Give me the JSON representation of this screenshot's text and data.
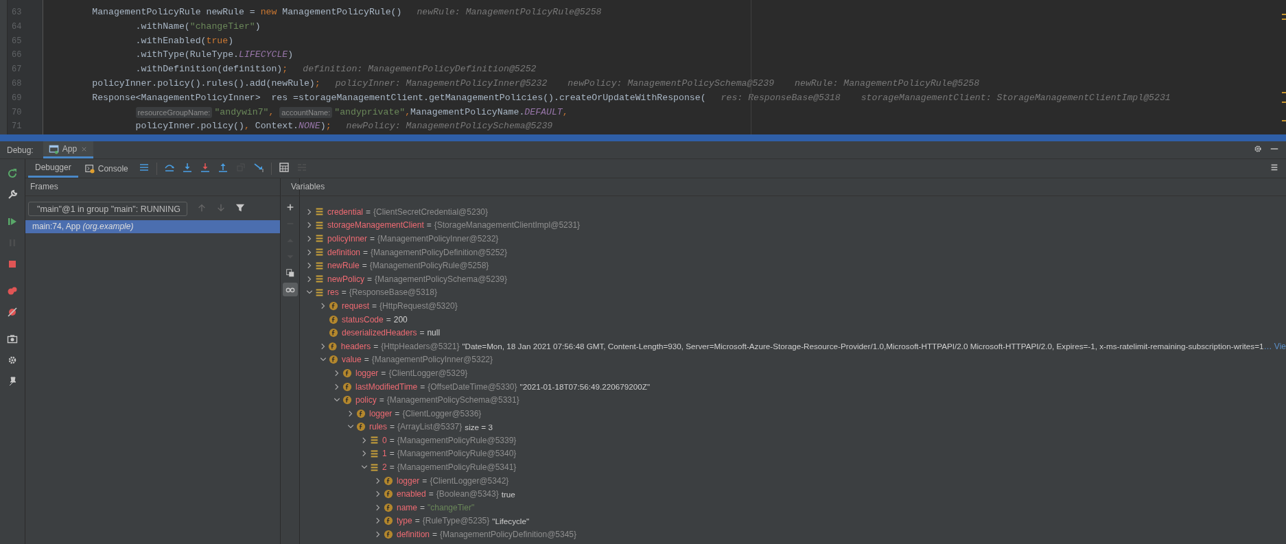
{
  "editor": {
    "lines": [
      {
        "number": "63",
        "continuation": false,
        "tokens": [
          {
            "kind": "plain",
            "text": "ManagementPolicyRule newRule = "
          },
          {
            "kind": "keyword",
            "text": "new"
          },
          {
            "kind": "plain",
            "text": " ManagementPolicyRule()"
          },
          {
            "kind": "hint",
            "text": "newRule: ManagementPolicyRule@5258"
          }
        ]
      },
      {
        "number": "64",
        "continuation": true,
        "tokens": [
          {
            "kind": "plain",
            "text": ".withName("
          },
          {
            "kind": "string",
            "text": "\"changeTier\""
          },
          {
            "kind": "plain",
            "text": ")"
          }
        ]
      },
      {
        "number": "65",
        "continuation": true,
        "tokens": [
          {
            "kind": "plain",
            "text": ".withEnabled("
          },
          {
            "kind": "keyword",
            "text": "true"
          },
          {
            "kind": "plain",
            "text": ")"
          }
        ]
      },
      {
        "number": "66",
        "continuation": true,
        "tokens": [
          {
            "kind": "plain",
            "text": ".withType(RuleType."
          },
          {
            "kind": "constant",
            "text": "LIFECYCLE"
          },
          {
            "kind": "plain",
            "text": ")"
          }
        ]
      },
      {
        "number": "67",
        "continuation": true,
        "tokens": [
          {
            "kind": "plain",
            "text": ".withDefinition(definition)"
          },
          {
            "kind": "keyword",
            "text": ";"
          },
          {
            "kind": "hint",
            "text": "definition: ManagementPolicyDefinition@5252"
          }
        ]
      },
      {
        "number": "68",
        "continuation": false,
        "tokens": [
          {
            "kind": "plain",
            "text": "policyInner.policy().rules().add(newRule)"
          },
          {
            "kind": "keyword",
            "text": ";"
          },
          {
            "kind": "hint",
            "text": "policyInner: ManagementPolicyInner@5232"
          },
          {
            "kind": "hint",
            "text": "newPolicy: ManagementPolicySchema@5239"
          },
          {
            "kind": "hint",
            "text": "newRule: ManagementPolicyRule@5258"
          }
        ]
      },
      {
        "number": "69",
        "continuation": false,
        "tokens": [
          {
            "kind": "plain",
            "text": "Response<ManagementPolicyInner>  res =storageManagementClient.getManagementPolicies().createOrUpdateWithResponse("
          },
          {
            "kind": "hint",
            "text": "res: ResponseBase@5318"
          },
          {
            "kind": "hint",
            "text": "storageManagementClient: StorageManagementClientImpl@5231"
          }
        ]
      },
      {
        "number": "70",
        "continuation": true,
        "tokens": [
          {
            "kind": "param",
            "text": "resourceGroupName:"
          },
          {
            "kind": "string",
            "text": "\"andywin7\""
          },
          {
            "kind": "keyword",
            "text": ", "
          },
          {
            "kind": "param",
            "text": "accountName:"
          },
          {
            "kind": "string",
            "text": "\"andyprivate\""
          },
          {
            "kind": "keyword",
            "text": ","
          },
          {
            "kind": "plain",
            "text": "ManagementPolicyName."
          },
          {
            "kind": "constant",
            "text": "DEFAULT"
          },
          {
            "kind": "keyword",
            "text": ","
          }
        ]
      },
      {
        "number": "71",
        "continuation": true,
        "tokens": [
          {
            "kind": "plain",
            "text": "policyInner.policy()"
          },
          {
            "kind": "keyword",
            "text": ","
          },
          {
            "kind": "plain",
            "text": " Context."
          },
          {
            "kind": "constant",
            "text": "NONE"
          },
          {
            "kind": "plain",
            "text": ")"
          },
          {
            "kind": "keyword",
            "text": ";"
          },
          {
            "kind": "hint",
            "text": "newPolicy: ManagementPolicySchema@5239"
          }
        ]
      }
    ]
  },
  "debug": {
    "label": "Debug:",
    "tabs": [
      {
        "label": "App",
        "selected": true
      }
    ],
    "subtabs": [
      {
        "label": "Debugger",
        "selected": true
      },
      {
        "label": "Console",
        "selected": false
      }
    ],
    "toolbar": [
      {
        "disabled": false
      },
      {
        "disabled": false
      },
      {
        "disabled": false
      },
      {
        "disabled": false
      },
      {
        "disabled": false
      },
      {
        "disabled": true
      },
      {
        "disabled": false
      },
      {
        "disabled": false
      },
      {
        "disabled": true
      }
    ],
    "side_toolbar": [
      {
        "disabled": false
      },
      {
        "disabled": false
      },
      {
        "disabled": false
      },
      {
        "disabled": true
      },
      {
        "disabled": false
      },
      {
        "disabled": false
      },
      {
        "disabled": false
      },
      {
        "disabled": false
      },
      {
        "disabled": false
      },
      {
        "disabled": false
      }
    ]
  },
  "frames": {
    "title": "Frames",
    "thread": "\"main\"@1 in group \"main\": RUNNING",
    "nav": [
      {
        "disabled": true
      },
      {
        "disabled": true
      }
    ],
    "items": [
      {
        "text": "main:74, App *(org.example)*",
        "selected": true
      }
    ]
  },
  "variables": {
    "title": "Variables",
    "side_buttons": [
      {
        "disabled": false,
        "selected": false
      },
      {
        "disabled": true,
        "selected": false
      },
      {
        "disabled": true,
        "selected": false
      },
      {
        "disabled": true,
        "selected": false
      },
      {
        "disabled": false,
        "selected": false
      },
      {
        "disabled": false,
        "selected": true
      }
    ],
    "tree": [
      {
        "kind": "local",
        "name": "credential",
        "eq": "=",
        "value": {
          "kind": "ref",
          "text": "{ClientSecretCredential@5230}"
        },
        "expanded": false
      },
      {
        "kind": "local",
        "name": "storageManagementClient",
        "eq": "=",
        "value": {
          "kind": "ref",
          "text": "{StorageManagementClientImpl@5231}"
        },
        "expanded": false
      },
      {
        "kind": "local",
        "name": "policyInner",
        "eq": "=",
        "value": {
          "kind": "ref",
          "text": "{ManagementPolicyInner@5232}"
        },
        "expanded": false
      },
      {
        "kind": "local",
        "name": "definition",
        "eq": "=",
        "value": {
          "kind": "ref",
          "text": "{ManagementPolicyDefinition@5252}"
        },
        "expanded": false
      },
      {
        "kind": "local",
        "name": "newRule",
        "eq": "=",
        "value": {
          "kind": "ref",
          "text": "{ManagementPolicyRule@5258}"
        },
        "expanded": false
      },
      {
        "kind": "local",
        "name": "newPolicy",
        "eq": "=",
        "value": {
          "kind": "ref",
          "text": "{ManagementPolicySchema@5239}"
        },
        "expanded": false
      },
      {
        "kind": "local",
        "name": "res",
        "eq": "=",
        "value": {
          "kind": "ref",
          "text": "{ResponseBase@5318}"
        },
        "expanded": true,
        "children": [
          {
            "kind": "field",
            "name": "request",
            "eq": "=",
            "value": {
              "kind": "ref",
              "text": "{HttpRequest@5320}"
            },
            "expanded": false
          },
          {
            "kind": "leaf_field",
            "name": "statusCode",
            "eq": "=",
            "value": {
              "kind": "plain",
              "text": "200"
            }
          },
          {
            "kind": "leaf_field",
            "name": "deserializedHeaders",
            "eq": "=",
            "value": {
              "kind": "plain",
              "text": "null"
            }
          },
          {
            "kind": "field",
            "name": "headers",
            "eq": "=",
            "value": {
              "kind": "ref",
              "text": "{HttpHeaders@5321}"
            },
            "extra": "\"Date=Mon, 18 Jan 2021 07:56:48 GMT, Content-Length=930, Server=Microsoft-Azure-Storage-Resource-Provider/1.0,Microsoft-HTTPAPI/2.0 Microsoft-HTTPAPI/2.0, Expires=-1, x-ms-ratelimit-remaining-subscription-writes=1",
            "link": "… Vie",
            "expanded": false
          },
          {
            "kind": "field",
            "name": "value",
            "eq": "=",
            "value": {
              "kind": "ref",
              "text": "{ManagementPolicyInner@5322}"
            },
            "expanded": true,
            "children": [
              {
                "kind": "field",
                "name": "logger",
                "eq": "=",
                "value": {
                  "kind": "ref",
                  "text": "{ClientLogger@5329}"
                },
                "expanded": false
              },
              {
                "kind": "field",
                "name": "lastModifiedTime",
                "eq": "=",
                "value": {
                  "kind": "ref",
                  "text": "{OffsetDateTime@5330}"
                },
                "extra": "\"2021-01-18T07:56:49.220679200Z\"",
                "expanded": false
              },
              {
                "kind": "field",
                "name": "policy",
                "eq": "=",
                "value": {
                  "kind": "ref",
                  "text": "{ManagementPolicySchema@5331}"
                },
                "expanded": true,
                "children": [
                  {
                    "kind": "field",
                    "name": "logger",
                    "eq": "=",
                    "value": {
                      "kind": "ref",
                      "text": "{ClientLogger@5336}"
                    },
                    "expanded": false
                  },
                  {
                    "kind": "field",
                    "name": "rules",
                    "eq": "=",
                    "value": {
                      "kind": "ref",
                      "text": "{ArrayList@5337}"
                    },
                    "extra": "size = 3",
                    "expanded": true,
                    "children": [
                      {
                        "kind": "local",
                        "name": "0",
                        "eq": "=",
                        "value": {
                          "kind": "ref",
                          "text": "{ManagementPolicyRule@5339}"
                        },
                        "expanded": false
                      },
                      {
                        "kind": "local",
                        "name": "1",
                        "eq": "=",
                        "value": {
                          "kind": "ref",
                          "text": "{ManagementPolicyRule@5340}"
                        },
                        "expanded": false
                      },
                      {
                        "kind": "local",
                        "name": "2",
                        "eq": "=",
                        "value": {
                          "kind": "ref",
                          "text": "{ManagementPolicyRule@5341}"
                        },
                        "expanded": true,
                        "children": [
                          {
                            "kind": "field",
                            "name": "logger",
                            "eq": "=",
                            "value": {
                              "kind": "ref",
                              "text": "{ClientLogger@5342}"
                            },
                            "expanded": false
                          },
                          {
                            "kind": "field",
                            "name": "enabled",
                            "eq": "=",
                            "value": {
                              "kind": "ref",
                              "text": "{Boolean@5343}"
                            },
                            "extra": "true",
                            "expanded": false
                          },
                          {
                            "kind": "field",
                            "name": "name",
                            "eq": "=",
                            "value": {
                              "kind": "string",
                              "text": "\"changeTier\""
                            },
                            "expanded": false
                          },
                          {
                            "kind": "field",
                            "name": "type",
                            "eq": "=",
                            "value": {
                              "kind": "ref",
                              "text": "{RuleType@5235}"
                            },
                            "extra": "\"Lifecycle\"",
                            "expanded": false
                          },
                          {
                            "kind": "field",
                            "name": "definition",
                            "eq": "=",
                            "value": {
                              "kind": "ref",
                              "text": "{ManagementPolicyDefinition@5345}"
                            },
                            "expanded": false
                          }
                        ]
                      }
                    ]
                  }
                ]
              }
            ]
          }
        ]
      }
    ]
  }
}
